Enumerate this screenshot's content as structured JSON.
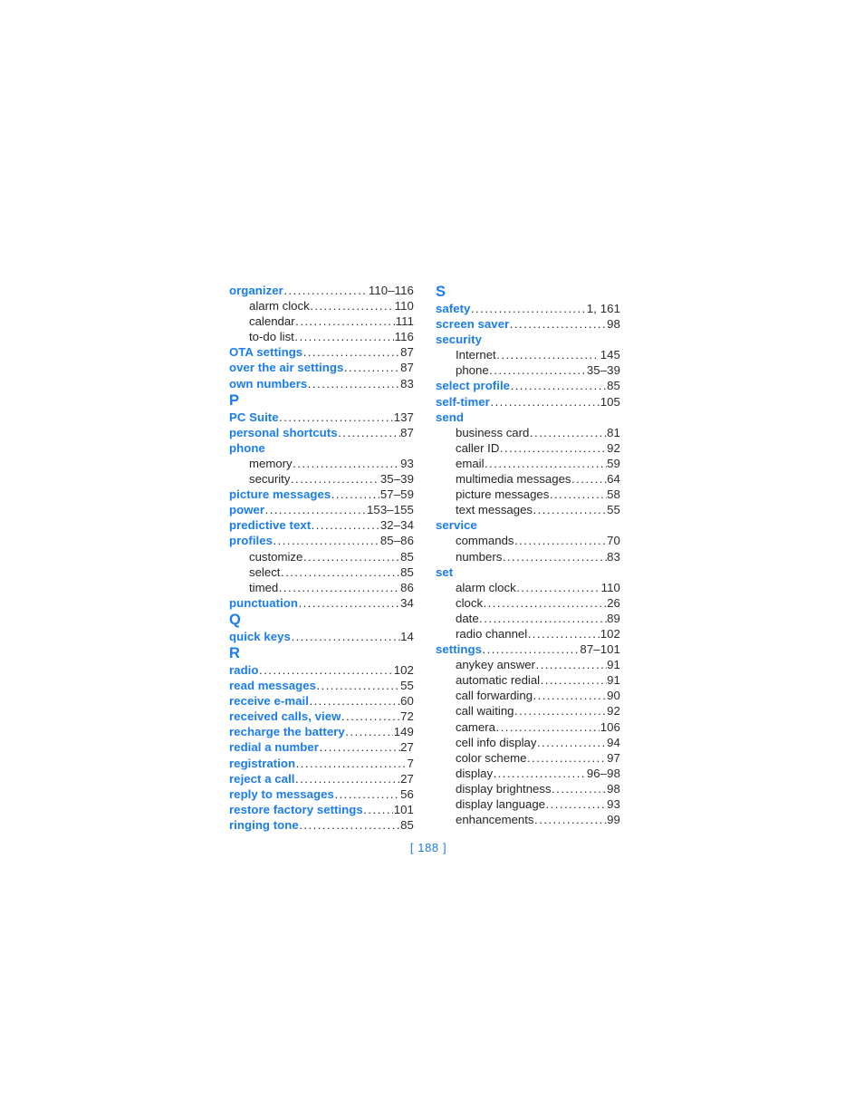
{
  "document": {
    "kind": "index-page",
    "page_label": "[ 188 ]",
    "colors": {
      "accent_blue": "#1a7ced",
      "body_text": "#242424",
      "background": "#ffffff"
    }
  },
  "columns": [
    {
      "name": "left-column",
      "blocks": [
        {
          "type": "entries",
          "entries": [
            {
              "level": "main",
              "term": "organizer",
              "page": "110–116"
            },
            {
              "level": "sub",
              "term": "alarm clock",
              "page": "110"
            },
            {
              "level": "sub",
              "term": "calendar",
              "page": "111"
            },
            {
              "level": "sub",
              "term": "to-do list",
              "page": "116"
            },
            {
              "level": "main",
              "term": "OTA settings",
              "page": "87"
            },
            {
              "level": "main",
              "term": "over the air settings",
              "page": "87"
            },
            {
              "level": "main",
              "term": "own numbers",
              "page": "83"
            }
          ]
        },
        {
          "type": "section",
          "letter": "P",
          "entries": [
            {
              "level": "main",
              "term": "PC Suite",
              "page": "137"
            },
            {
              "level": "main",
              "term": "personal shortcuts",
              "page": "87"
            },
            {
              "level": "main",
              "term": "phone",
              "page": ""
            },
            {
              "level": "sub",
              "term": "memory",
              "page": "93"
            },
            {
              "level": "sub",
              "term": "security",
              "page": "35–39"
            },
            {
              "level": "main",
              "term": "picture messages",
              "page": "57–59"
            },
            {
              "level": "main",
              "term": "power",
              "page": "153–155"
            },
            {
              "level": "main",
              "term": "predictive text",
              "page": "32–34"
            },
            {
              "level": "main",
              "term": "profiles",
              "page": "85–86"
            },
            {
              "level": "sub",
              "term": "customize",
              "page": "85"
            },
            {
              "level": "sub",
              "term": "select",
              "page": "85"
            },
            {
              "level": "sub",
              "term": "timed",
              "page": "86"
            },
            {
              "level": "main",
              "term": "punctuation",
              "page": "34"
            }
          ]
        },
        {
          "type": "section",
          "letter": "Q",
          "entries": [
            {
              "level": "main",
              "term": "quick keys",
              "page": "14"
            }
          ]
        },
        {
          "type": "section",
          "letter": "R",
          "entries": [
            {
              "level": "main",
              "term": "radio",
              "page": "102"
            },
            {
              "level": "main",
              "term": "read messages",
              "page": "55"
            },
            {
              "level": "main",
              "term": "receive e-mail",
              "page": "60"
            },
            {
              "level": "main",
              "term": "received calls, view",
              "page": "72"
            },
            {
              "level": "main",
              "term": "recharge the battery",
              "page": "149"
            },
            {
              "level": "main",
              "term": "redial a number",
              "page": "27"
            },
            {
              "level": "main",
              "term": "registration",
              "page": "7"
            },
            {
              "level": "main",
              "term": "reject a call",
              "page": "27"
            },
            {
              "level": "main",
              "term": "reply to messages",
              "page": "56"
            },
            {
              "level": "main",
              "term": "restore factory settings",
              "page": "101"
            },
            {
              "level": "main",
              "term": "ringing tone",
              "page": "85"
            }
          ]
        }
      ]
    },
    {
      "name": "right-column",
      "blocks": [
        {
          "type": "section",
          "letter": "S",
          "entries": [
            {
              "level": "main",
              "term": "safety",
              "page": "1, 161"
            },
            {
              "level": "main",
              "term": "screen saver",
              "page": "98"
            },
            {
              "level": "main",
              "term": "security",
              "page": ""
            },
            {
              "level": "sub",
              "term": "Internet",
              "page": "145"
            },
            {
              "level": "sub",
              "term": "phone",
              "page": "35–39"
            },
            {
              "level": "main",
              "term": "select profile",
              "page": "85"
            },
            {
              "level": "main",
              "term": "self-timer",
              "page": "105"
            },
            {
              "level": "main",
              "term": "send",
              "page": ""
            },
            {
              "level": "sub",
              "term": "business card",
              "page": "81"
            },
            {
              "level": "sub",
              "term": "caller ID",
              "page": "92"
            },
            {
              "level": "sub",
              "term": "email",
              "page": "59"
            },
            {
              "level": "sub",
              "term": "multimedia messages",
              "page": "64"
            },
            {
              "level": "sub",
              "term": "picture messages",
              "page": "58"
            },
            {
              "level": "sub",
              "term": "text messages",
              "page": "55"
            },
            {
              "level": "main",
              "term": "service",
              "page": ""
            },
            {
              "level": "sub",
              "term": "commands",
              "page": "70"
            },
            {
              "level": "sub",
              "term": "numbers",
              "page": "83"
            },
            {
              "level": "main",
              "term": "set",
              "page": ""
            },
            {
              "level": "sub",
              "term": "alarm clock",
              "page": "110"
            },
            {
              "level": "sub",
              "term": "clock",
              "page": "26"
            },
            {
              "level": "sub",
              "term": "date",
              "page": "89"
            },
            {
              "level": "sub",
              "term": "radio channel",
              "page": "102"
            },
            {
              "level": "main",
              "term": "settings",
              "page": "87–101"
            },
            {
              "level": "sub",
              "term": "anykey answer",
              "page": "91"
            },
            {
              "level": "sub",
              "term": "automatic redial",
              "page": "91"
            },
            {
              "level": "sub",
              "term": "call forwarding",
              "page": "90"
            },
            {
              "level": "sub",
              "term": "call waiting",
              "page": "92"
            },
            {
              "level": "sub",
              "term": "camera",
              "page": "106"
            },
            {
              "level": "sub",
              "term": "cell info display",
              "page": "94"
            },
            {
              "level": "sub",
              "term": "color scheme",
              "page": "97"
            },
            {
              "level": "sub",
              "term": "display",
              "page": "96–98"
            },
            {
              "level": "sub",
              "term": "display brightness",
              "page": "98"
            },
            {
              "level": "sub",
              "term": "display language",
              "page": "93"
            },
            {
              "level": "sub",
              "term": "enhancements",
              "page": "99"
            }
          ]
        }
      ]
    }
  ]
}
